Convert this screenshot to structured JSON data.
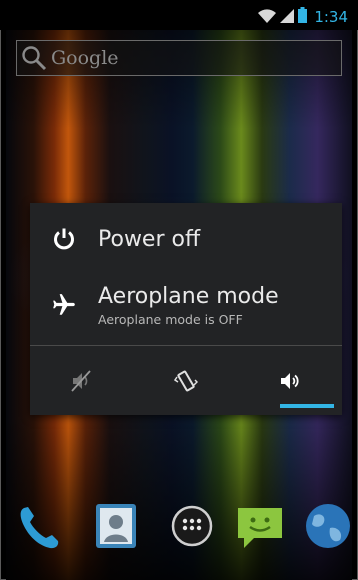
{
  "status_bar": {
    "time": "1:34",
    "icons": [
      "wifi-icon",
      "signal-icon",
      "battery-icon"
    ],
    "accent_color": "#33b5e5"
  },
  "search": {
    "placeholder": "Google",
    "icon": "search-icon"
  },
  "power_dialog": {
    "items": [
      {
        "icon": "power-icon",
        "title": "Power off"
      },
      {
        "icon": "airplane-icon",
        "title": "Aeroplane mode",
        "subtitle": "Aeroplane mode is OFF"
      }
    ],
    "sound_modes": [
      {
        "icon": "silent-icon",
        "name": "Silent"
      },
      {
        "icon": "vibrate-icon",
        "name": "Vibrate"
      },
      {
        "icon": "sound-on-icon",
        "name": "Sound on",
        "selected": true
      }
    ],
    "background_color": "#222325"
  },
  "dock": {
    "apps": [
      "phone-icon",
      "contacts-icon",
      "all-apps-icon",
      "messaging-icon",
      "browser-icon"
    ]
  }
}
